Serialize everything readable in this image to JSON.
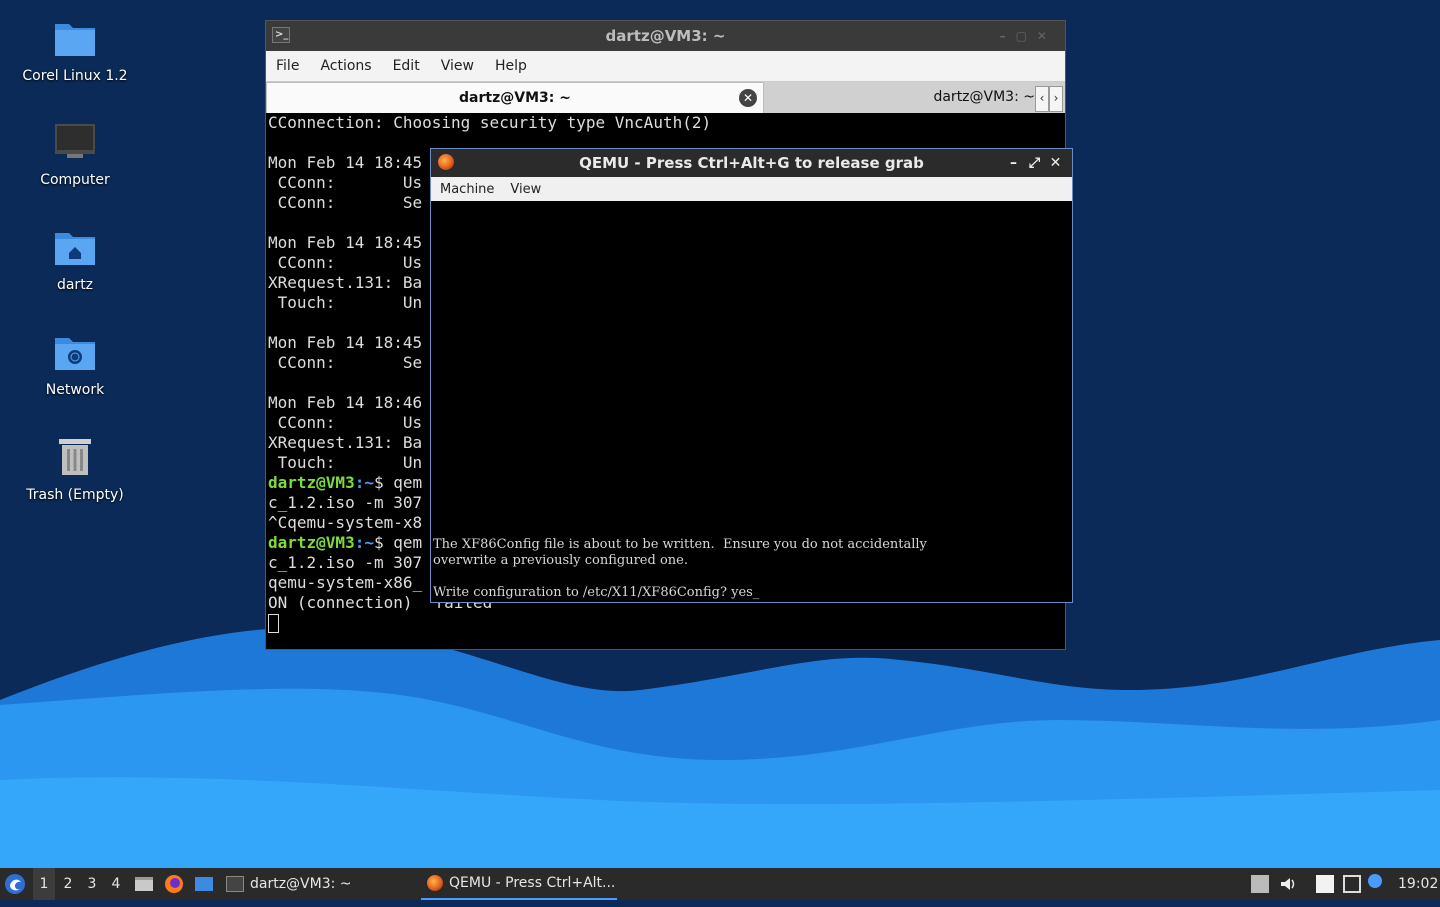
{
  "desktop": {
    "icons": [
      {
        "label": "Corel Linux 1.2"
      },
      {
        "label": "Computer"
      },
      {
        "label": "dartz"
      },
      {
        "label": "Network"
      },
      {
        "label": "Trash (Empty)"
      }
    ]
  },
  "terminal": {
    "title": "dartz@VM3: ~",
    "menu": [
      "File",
      "Actions",
      "Edit",
      "View",
      "Help"
    ],
    "tabs": [
      {
        "label": "dartz@VM3: ~"
      },
      {
        "label": "dartz@VM3: ~"
      }
    ],
    "lines": [
      "CConnection: Choosing security type VncAuth(2)",
      "",
      "Mon Feb 14 18:45",
      " CConn:       Us",
      " CConn:       Se",
      "",
      "Mon Feb 14 18:45",
      " CConn:       Us",
      "XRequest.131: Ba",
      " Touch:       Un",
      "",
      "Mon Feb 14 18:45",
      " CConn:       Se",
      "",
      "Mon Feb 14 18:46",
      " CConn:       Us",
      "XRequest.131: Ba",
      " Touch:       Un"
    ],
    "prompt_user": "dartz@VM3",
    "prompt_path": ":~",
    "prompt_symbol": "$ qem",
    "cmd1_cont": "c_1.2.iso -m 307",
    "interrupt": "^Cqemu-system-x8",
    "cmd2_cont": "c_1.2.iso -m 307",
    "error_line1": "qemu-system-x86_",
    "error_line2": "ON (connection)",
    "error_tail": "failed"
  },
  "qemu": {
    "title": "QEMU - Press Ctrl+Alt+G to release grab",
    "menu": [
      "Machine",
      "View"
    ],
    "screen_lines": [
      "The XF86Config file is about to be written.  Ensure you do not accidentally",
      "overwrite a previously configured one.",
      "Write configuration to /etc/X11/XF86Config? yes_"
    ]
  },
  "taskbar": {
    "workspaces": [
      "1",
      "2",
      "3",
      "4"
    ],
    "apps": [
      {
        "label": "dartz@VM3: ~"
      },
      {
        "label": "QEMU - Press Ctrl+Alt..."
      }
    ],
    "clock": "19:02"
  }
}
